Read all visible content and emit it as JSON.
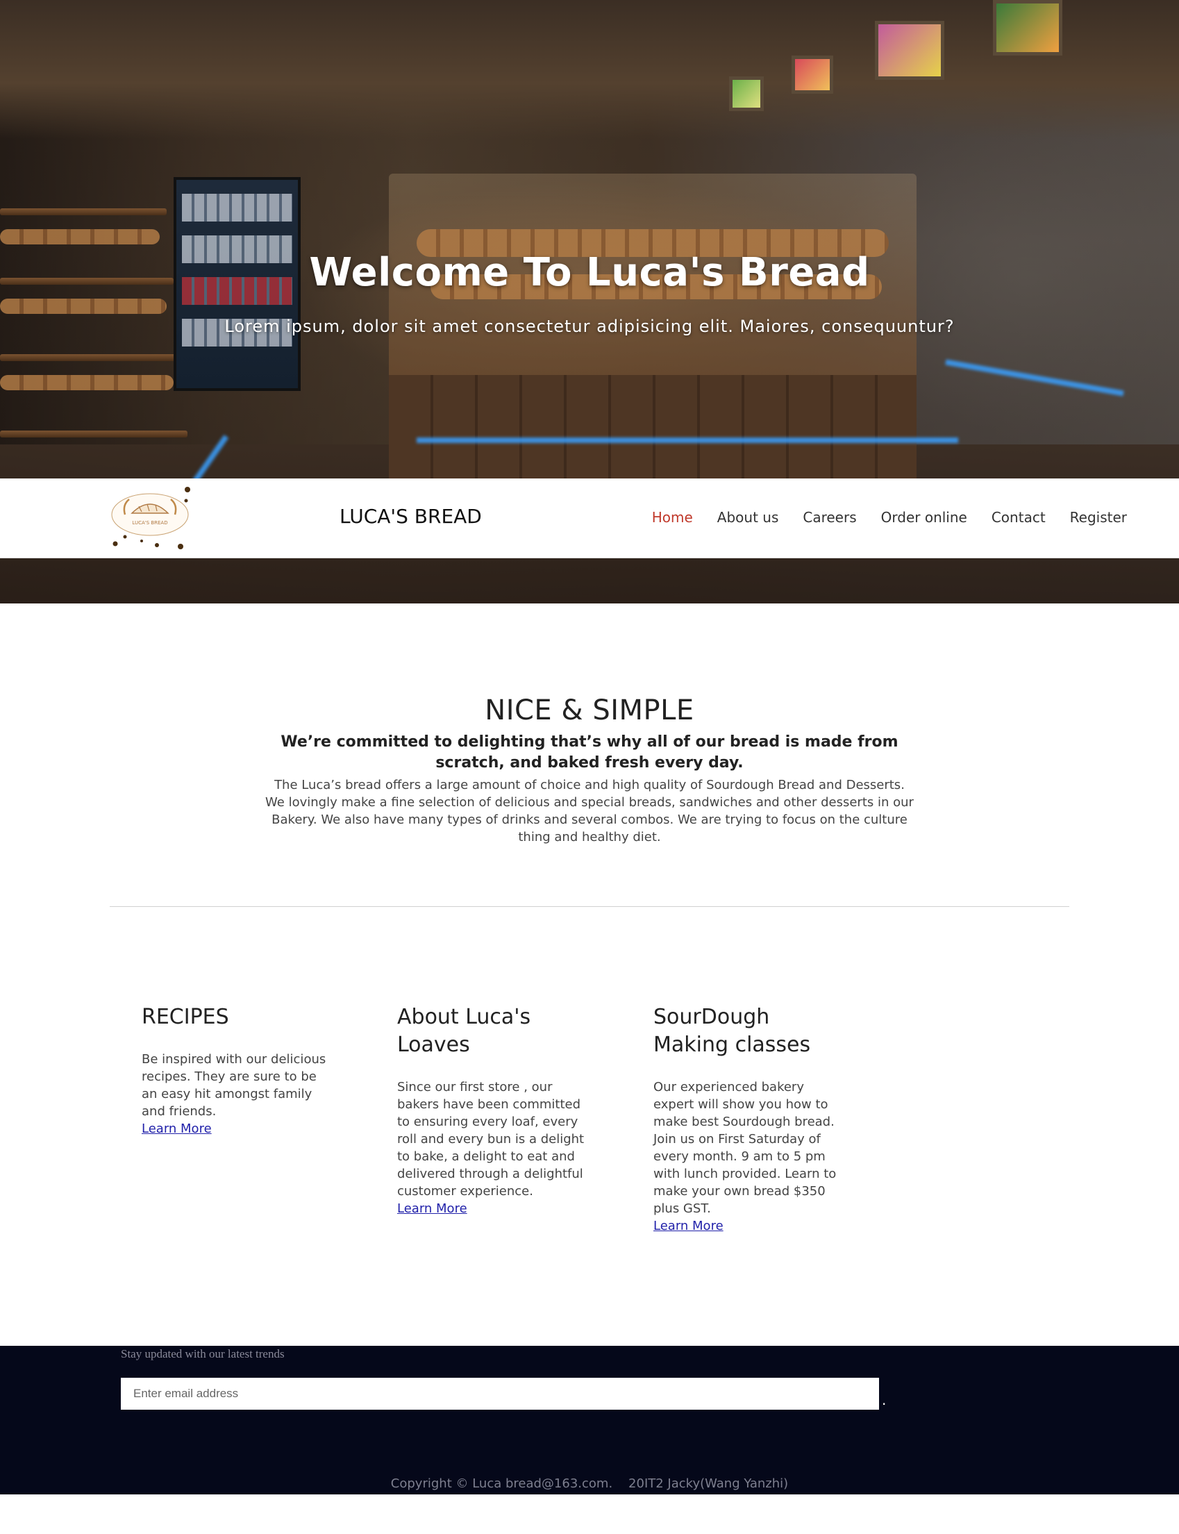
{
  "hero": {
    "title": "Welcome To Luca's Bread",
    "subtitle": "Lorem ipsum, dolor sit amet consectetur adipisicing elit. Maiores, consequuntur?"
  },
  "navbar": {
    "logo_text": "LUCA'S BREAD",
    "brand": "LUCA'S BREAD",
    "items": [
      {
        "label": "Home",
        "active": true
      },
      {
        "label": "About us",
        "active": false
      },
      {
        "label": "Careers",
        "active": false
      },
      {
        "label": "Order online",
        "active": false
      },
      {
        "label": "Contact",
        "active": false
      },
      {
        "label": "Register",
        "active": false
      }
    ],
    "active_color": "#c0392b"
  },
  "intro": {
    "heading": "NICE & SIMPLE",
    "lead": "We’re committed to delighting that’s why all of our bread is made from scratch, and baked fresh every day.",
    "body": "The Luca’s bread offers a large amount of choice and high quality of Sourdough Bread and Desserts. We lovingly make a fine selection of delicious and special breads, sandwiches and other desserts in our Bakery. We also have many types of drinks and several combos. We are trying to focus on the culture thing and healthy diet."
  },
  "columns": [
    {
      "title": "RECIPES",
      "text": "Be inspired with our delicious recipes. They are sure to be an easy hit amongst family and friends.",
      "link": "Learn More"
    },
    {
      "title": "About Luca's Loaves",
      "text": "Since our first store , our bakers have been committed to ensuring every loaf, every roll and every bun is a delight to bake, a delight to eat and delivered through a delightful customer experience.",
      "link": "Learn More"
    },
    {
      "title": "SourDough Making classes",
      "text": "Our experienced bakery expert will show you how to make best Sourdough bread. Join us on First Saturday of every month. 9 am to 5 pm with lunch provided. Learn to make your own bread $350 plus GST.",
      "link": "Learn More"
    }
  ],
  "footer": {
    "tagline": "Stay updated with our latest trends",
    "email_placeholder": "Enter email address",
    "dot": ".",
    "copyright": "Copyright © Luca bread@163.com.    20IT2 Jacky(Wang Yanzhi)",
    "background": "#05081a"
  }
}
